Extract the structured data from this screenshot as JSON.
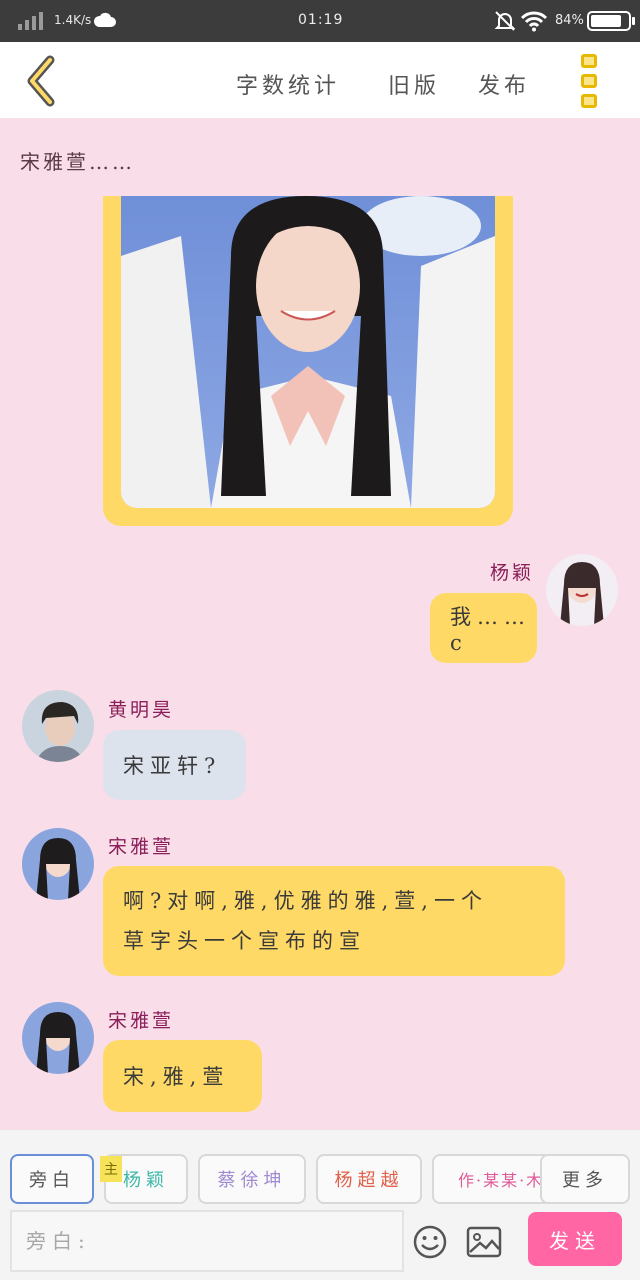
{
  "status_bar": {
    "network_speed": "1.4K/s",
    "time": "01:19",
    "battery": "84%"
  },
  "header": {
    "actions": [
      "字数统计",
      "旧版",
      "发布"
    ]
  },
  "chat": {
    "narration": "宋雅萱……",
    "messages": [
      {
        "sender": "杨颖",
        "text": "我……c",
        "side": "right",
        "bubble_color": "#ffd966"
      },
      {
        "sender": "黄明昊",
        "text": "宋亚轩?",
        "side": "left",
        "bubble_color": "#dde3ec"
      },
      {
        "sender": "宋雅萱",
        "text_lines": [
          "啊?对啊,雅,优雅的雅,萱,一个",
          "草字头一个宣布的宣"
        ],
        "side": "left",
        "bubble_color": "#ffd966"
      },
      {
        "sender": "宋雅萱",
        "text": "宋,雅,萱",
        "side": "left",
        "bubble_color": "#ffd966"
      }
    ]
  },
  "roles": {
    "tabs": [
      {
        "label": "旁白",
        "color": "#555555"
      },
      {
        "label": "杨颖",
        "color": "#3bb8a8"
      },
      {
        "label": "蔡徐坤",
        "color": "#a08ad0"
      },
      {
        "label": "杨超越",
        "color": "#e0604a"
      },
      {
        "label": "作·某某·木",
        "color": "#e05a9a"
      },
      {
        "label": "更多",
        "color": "#555555"
      }
    ],
    "main_badge": "主"
  },
  "composer": {
    "placeholder": "旁白:",
    "send_label": "发送"
  },
  "colors": {
    "background": "#f9dde8",
    "accent_yellow": "#ffd966",
    "send_pink": "#ff66a3"
  }
}
